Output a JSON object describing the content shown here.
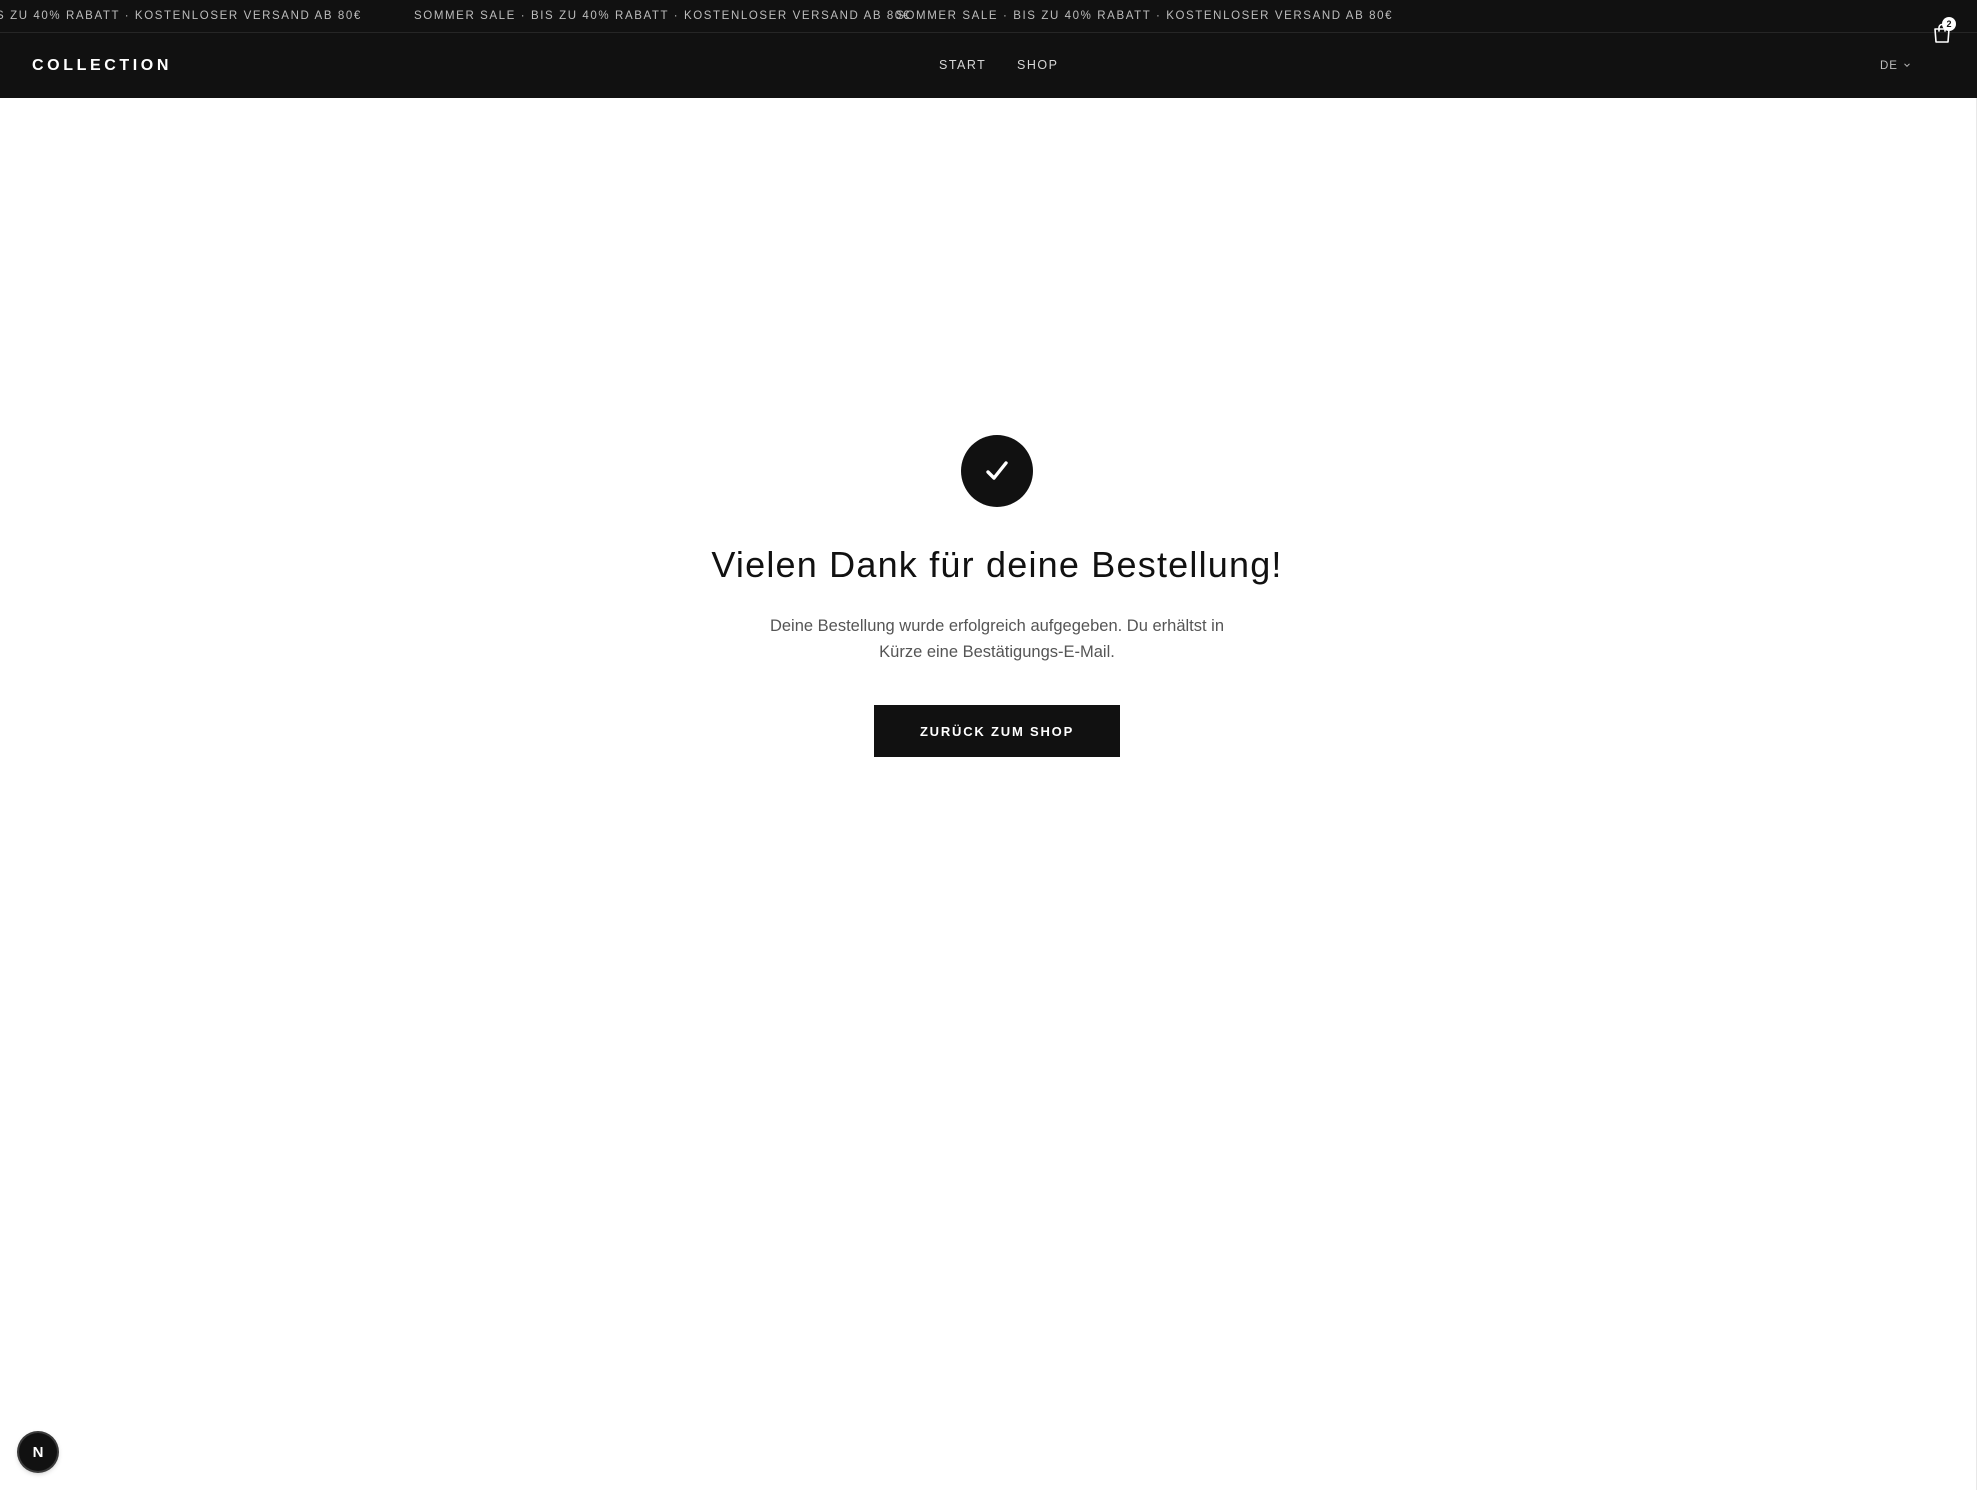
{
  "announcement": {
    "segments": [
      "S ZU 40% RABATT · KOSTENLOSER VERSAND AB 80€",
      "SOMMER SALE · BIS ZU 40% RABATT · KOSTENLOSER VERSAND AB 80€",
      "· SOMMER SALE · BIS ZU 40% RABATT · KOSTENLOSER VERSAND AB 80€"
    ]
  },
  "header": {
    "logo": "COLLECTION",
    "nav": [
      {
        "label": "START"
      },
      {
        "label": "SHOP"
      }
    ],
    "language": "DE",
    "cart_count": "2"
  },
  "confirmation": {
    "icon": "check-icon",
    "title": "Vielen Dank für deine Bestellung!",
    "line1": "Deine Bestellung wurde erfolgreich aufgegeben. Du erhältst in",
    "line2": "Kürze eine Bestätigungs-E-Mail.",
    "button_label": "ZURÜCK ZUM SHOP"
  },
  "dev_indicator": {
    "label": "N"
  },
  "colors": {
    "header_bg": "#111111",
    "page_bg": "#ffffff",
    "text_primary": "#111111",
    "text_secondary": "#555555",
    "announcement_text": "#bdbdbd"
  }
}
